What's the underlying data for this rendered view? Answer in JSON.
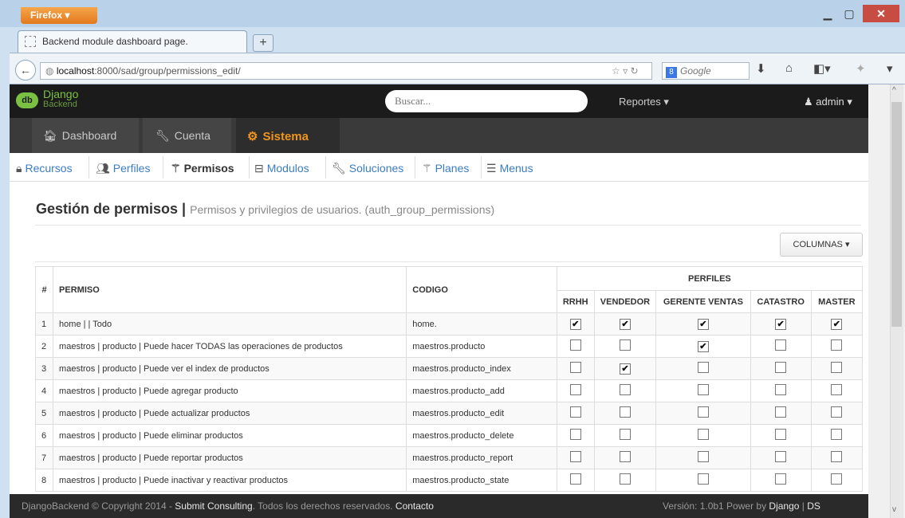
{
  "browser": {
    "firefox_label": "Firefox",
    "tab_title": "Backend module dashboard page.",
    "new_tab": "+",
    "url_host": "localhost",
    "url_rest": ":8000/sad/group/permissions_edit/",
    "search_placeholder": "Google"
  },
  "app": {
    "logo_abbr": "db",
    "logo_name": "Django",
    "logo_sub": "Backend",
    "search_placeholder": "Buscar...",
    "reportes": "Reportes",
    "admin": "admin"
  },
  "main_nav": [
    {
      "label": "Dashboard",
      "icon": "home-icon"
    },
    {
      "label": "Cuenta",
      "icon": "wrench-icon"
    },
    {
      "label": "Sistema",
      "icon": "cogs-icon"
    }
  ],
  "sub_nav": [
    {
      "label": "Recursos",
      "icon": "lock-icon"
    },
    {
      "label": "Perfiles",
      "icon": "users-icon"
    },
    {
      "label": "Permisos",
      "icon": "wand-icon"
    },
    {
      "label": "Modulos",
      "icon": "hdd-icon"
    },
    {
      "label": "Soluciones",
      "icon": "wrench-icon"
    },
    {
      "label": "Planes",
      "icon": "wand-icon"
    },
    {
      "label": "Menus",
      "icon": "list-icon"
    }
  ],
  "page": {
    "title": "Gestión de permisos |",
    "subtitle": "Permisos y privilegios de usuarios. (auth_group_permissions)",
    "columns_button": "COLUMNAS"
  },
  "table": {
    "headers": {
      "num": "#",
      "permiso": "PERMISO",
      "codigo": "CODIGO",
      "perfiles": "PERFILES"
    },
    "profiles": [
      "RRHH",
      "VENDEDOR",
      "GERENTE VENTAS",
      "CATASTRO",
      "MASTER"
    ],
    "rows": [
      {
        "num": "1",
        "permiso": "home | | Todo",
        "codigo": "home.",
        "checks": [
          true,
          true,
          true,
          true,
          true
        ]
      },
      {
        "num": "2",
        "permiso": "maestros | producto | Puede hacer TODAS las operaciones de productos",
        "codigo": "maestros.producto",
        "checks": [
          false,
          false,
          true,
          false,
          false
        ]
      },
      {
        "num": "3",
        "permiso": "maestros | producto | Puede ver el index de productos",
        "codigo": "maestros.producto_index",
        "checks": [
          false,
          true,
          false,
          false,
          false
        ]
      },
      {
        "num": "4",
        "permiso": "maestros | producto | Puede agregar producto",
        "codigo": "maestros.producto_add",
        "checks": [
          false,
          false,
          false,
          false,
          false
        ]
      },
      {
        "num": "5",
        "permiso": "maestros | producto | Puede actualizar productos",
        "codigo": "maestros.producto_edit",
        "checks": [
          false,
          false,
          false,
          false,
          false
        ]
      },
      {
        "num": "6",
        "permiso": "maestros | producto | Puede eliminar productos",
        "codigo": "maestros.producto_delete",
        "checks": [
          false,
          false,
          false,
          false,
          false
        ]
      },
      {
        "num": "7",
        "permiso": "maestros | producto | Puede reportar productos",
        "codigo": "maestros.producto_report",
        "checks": [
          false,
          false,
          false,
          false,
          false
        ]
      },
      {
        "num": "8",
        "permiso": "maestros | producto | Puede inactivar y reactivar productos",
        "codigo": "maestros.producto_state",
        "checks": [
          false,
          false,
          false,
          false,
          false
        ]
      }
    ]
  },
  "footer": {
    "left_1": "DjangoBackend © Copyright 2014 - ",
    "company": "Submit Consulting",
    "left_2": ". Todos los derechos reservados. ",
    "contact": "Contacto",
    "right_1": "Versión: 1.0b1 Power by ",
    "django": "Django",
    "sep": " | ",
    "ds": "DS"
  }
}
